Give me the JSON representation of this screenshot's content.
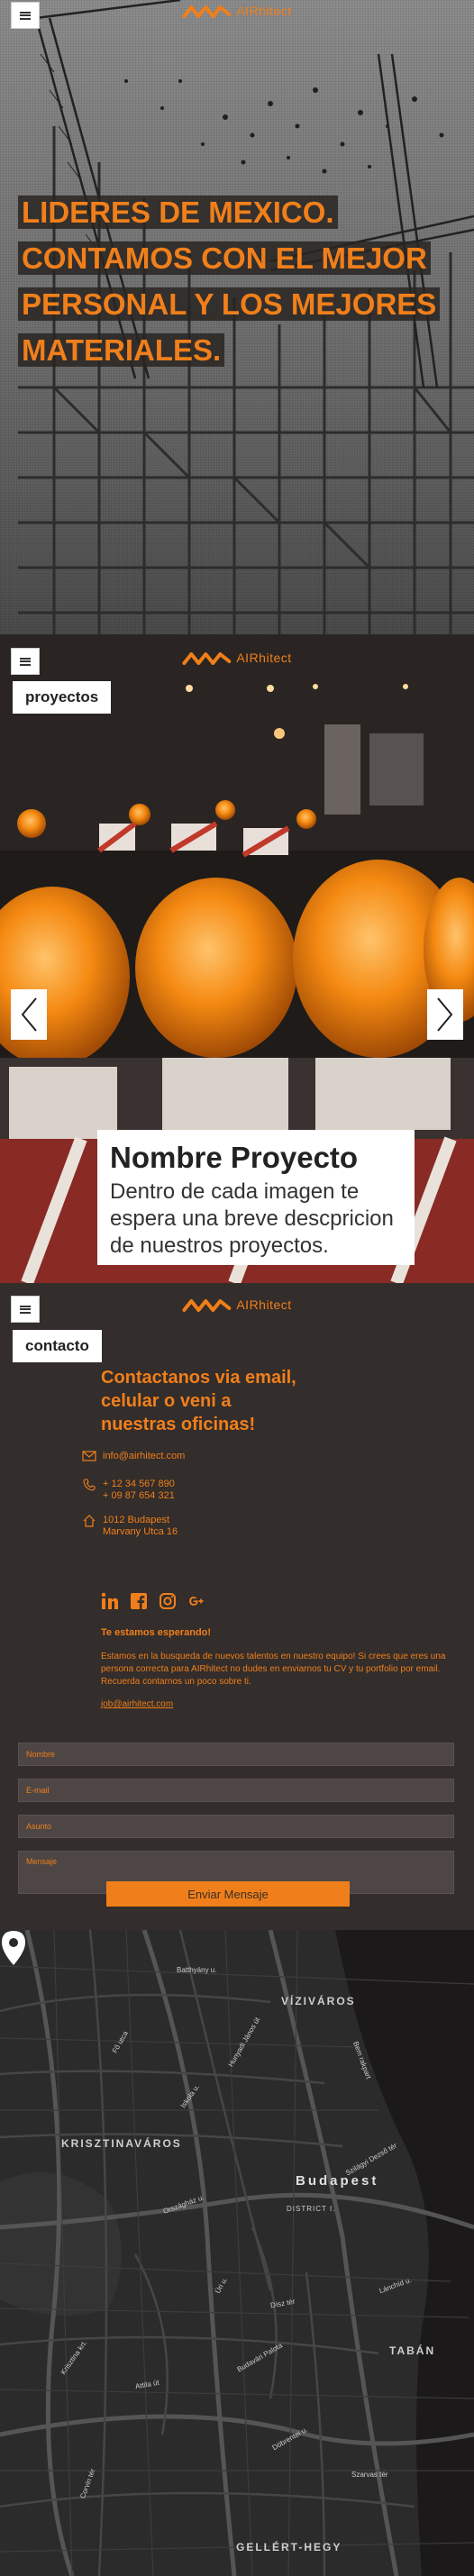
{
  "brand": {
    "name": "AIRhitect",
    "accent_color": "#f07f1b"
  },
  "hero": {
    "title_lines": [
      "LIDERES DE MEXICO.",
      "CONTAMOS CON EL MEJOR",
      "PERSONAL Y LOS MEJORES",
      "MATERIALES."
    ]
  },
  "proyectos": {
    "tab_label": "proyectos",
    "project_title": "Nombre Proyecto",
    "project_description": "Dentro de cada imagen te espera una breve descpricion de nuestros proyectos.",
    "prev_icon": "chevron-left-icon",
    "next_icon": "chevron-right-icon"
  },
  "contacto": {
    "tab_label": "contacto",
    "heading": "Contactanos via email, celular o veni a nuestras oficinas!",
    "email": "info@airhitect.com",
    "phone_1": "+ 12 34 567 890",
    "phone_2": "+ 09 87 654 321",
    "address_1": "1012 Budapest",
    "address_2": "Marvany Utca 16",
    "socials": [
      "linkedin-icon",
      "facebook-icon",
      "instagram-icon",
      "google-plus-icon"
    ],
    "talent_title": "Te estamos esperando!",
    "talent_text": "Estamos en la busqueda de nuevos talentos en nuestro equipo! Si crees que eres una persona correcta para AIRhitect no dudes en enviarnos tu CV y tu portfolio por email. Recuerda contarnos un poco sobre ti.",
    "talent_email": "job@airhitect.com",
    "form": {
      "name_placeholder": "Nombre",
      "email_placeholder": "E-mail",
      "subject_placeholder": "Asunto",
      "message_placeholder": "Mensaje",
      "send_label": "Enviar Mensaje"
    }
  },
  "mapa": {
    "city": "Budapest",
    "district": "DISTRICT I.",
    "areas": [
      "VÍZIVÁROS",
      "KRISZTINAVÁROS",
      "TABÁN",
      "GELLÉRT-HEGY"
    ],
    "streets": [
      "Bem rakpart",
      "Szilágyi Dezső tér",
      "Fő utca",
      "Attila út",
      "Krisztina krt.",
      "Hunyadi János út",
      "Corvin tér",
      "Batthyány u.",
      "Döbrentei u.",
      "Szarvas tér",
      "Iskola u.",
      "Lánchíd u.",
      "Budavári Palota",
      "Dísz tér",
      "Úri u.",
      "Országház u."
    ]
  }
}
